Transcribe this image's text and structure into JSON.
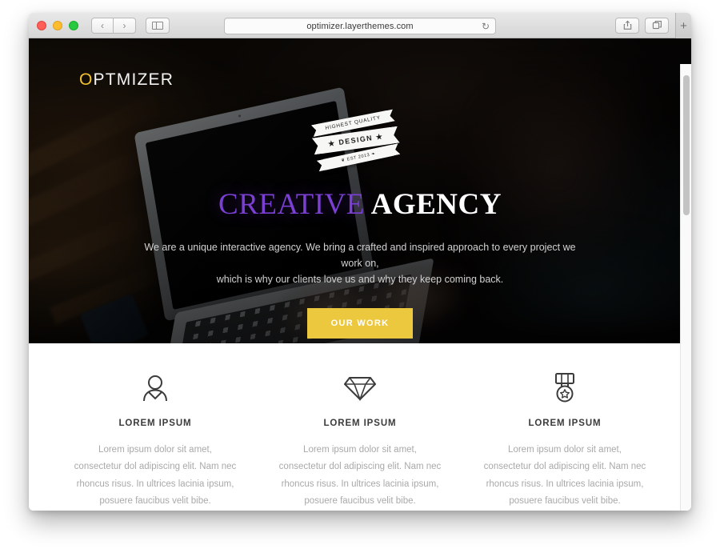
{
  "browser": {
    "url": "optimizer.layerthemes.com",
    "traffic_lights": [
      "close",
      "minimize",
      "maximize"
    ],
    "back_label": "‹",
    "forward_label": "›",
    "reload_label": "↻",
    "new_tab_label": "+",
    "sidebar_button_name": "show-sidebar",
    "share_button_name": "share",
    "tabs_button_name": "show-tabs"
  },
  "site": {
    "logo": {
      "first_letter": "O",
      "rest": "PTMIZER",
      "accent_color": "#f2c230"
    },
    "hero": {
      "title_part1": "CREATIVE",
      "title_part2": "AGENCY",
      "title_color_1": "#7b3fd4",
      "title_color_2": "#ffffff",
      "subtitle_line1": "We are a unique interactive agency. We bring a crafted and inspired approach to every project we work on,",
      "subtitle_line2": "which is why our clients love us and why they keep coming back.",
      "cta_label": "OUR WORK",
      "cta_color": "#ecc83f",
      "badge": {
        "line1": "HIGHEST QUALITY",
        "line2": "★ DESIGN ★",
        "line3": "❦  EST 2013  ❧"
      }
    },
    "features": [
      {
        "icon": "person-icon",
        "title": "LOREM IPSUM",
        "text": "Lorem ipsum dolor sit amet, consectetur dol adipiscing elit. Nam nec rhoncus risus. In ultrices lacinia ipsum, posuere faucibus velit bibe."
      },
      {
        "icon": "diamond-icon",
        "title": "LOREM IPSUM",
        "text": "Lorem ipsum dolor sit amet, consectetur dol adipiscing elit. Nam nec rhoncus risus. In ultrices lacinia ipsum, posuere faucibus velit bibe."
      },
      {
        "icon": "medal-icon",
        "title": "LOREM IPSUM",
        "text": "Lorem ipsum dolor sit amet, consectetur dol adipiscing elit. Nam nec rhoncus risus. In ultrices lacinia ipsum, posuere faucibus velit bibe."
      }
    ]
  }
}
